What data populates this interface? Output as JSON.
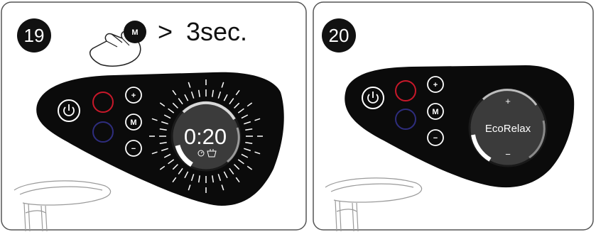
{
  "panels": [
    {
      "step": "19",
      "instruction": {
        "button_label": "M",
        "operator": ">",
        "duration": "3sec."
      },
      "display": {
        "value": "0:20"
      },
      "buttons": {
        "plus": "+",
        "mode": "M",
        "minus": "−"
      }
    },
    {
      "step": "20",
      "display": {
        "value": "EcoRelax",
        "plus": "+",
        "minus": "−"
      },
      "buttons": {
        "plus": "+",
        "mode": "M",
        "minus": "−"
      }
    }
  ],
  "colors": {
    "panel_black": "#0b0b0b",
    "red_ring": "#c8182a",
    "blue_ring": "#2e2d7e",
    "frame": "#555555"
  }
}
